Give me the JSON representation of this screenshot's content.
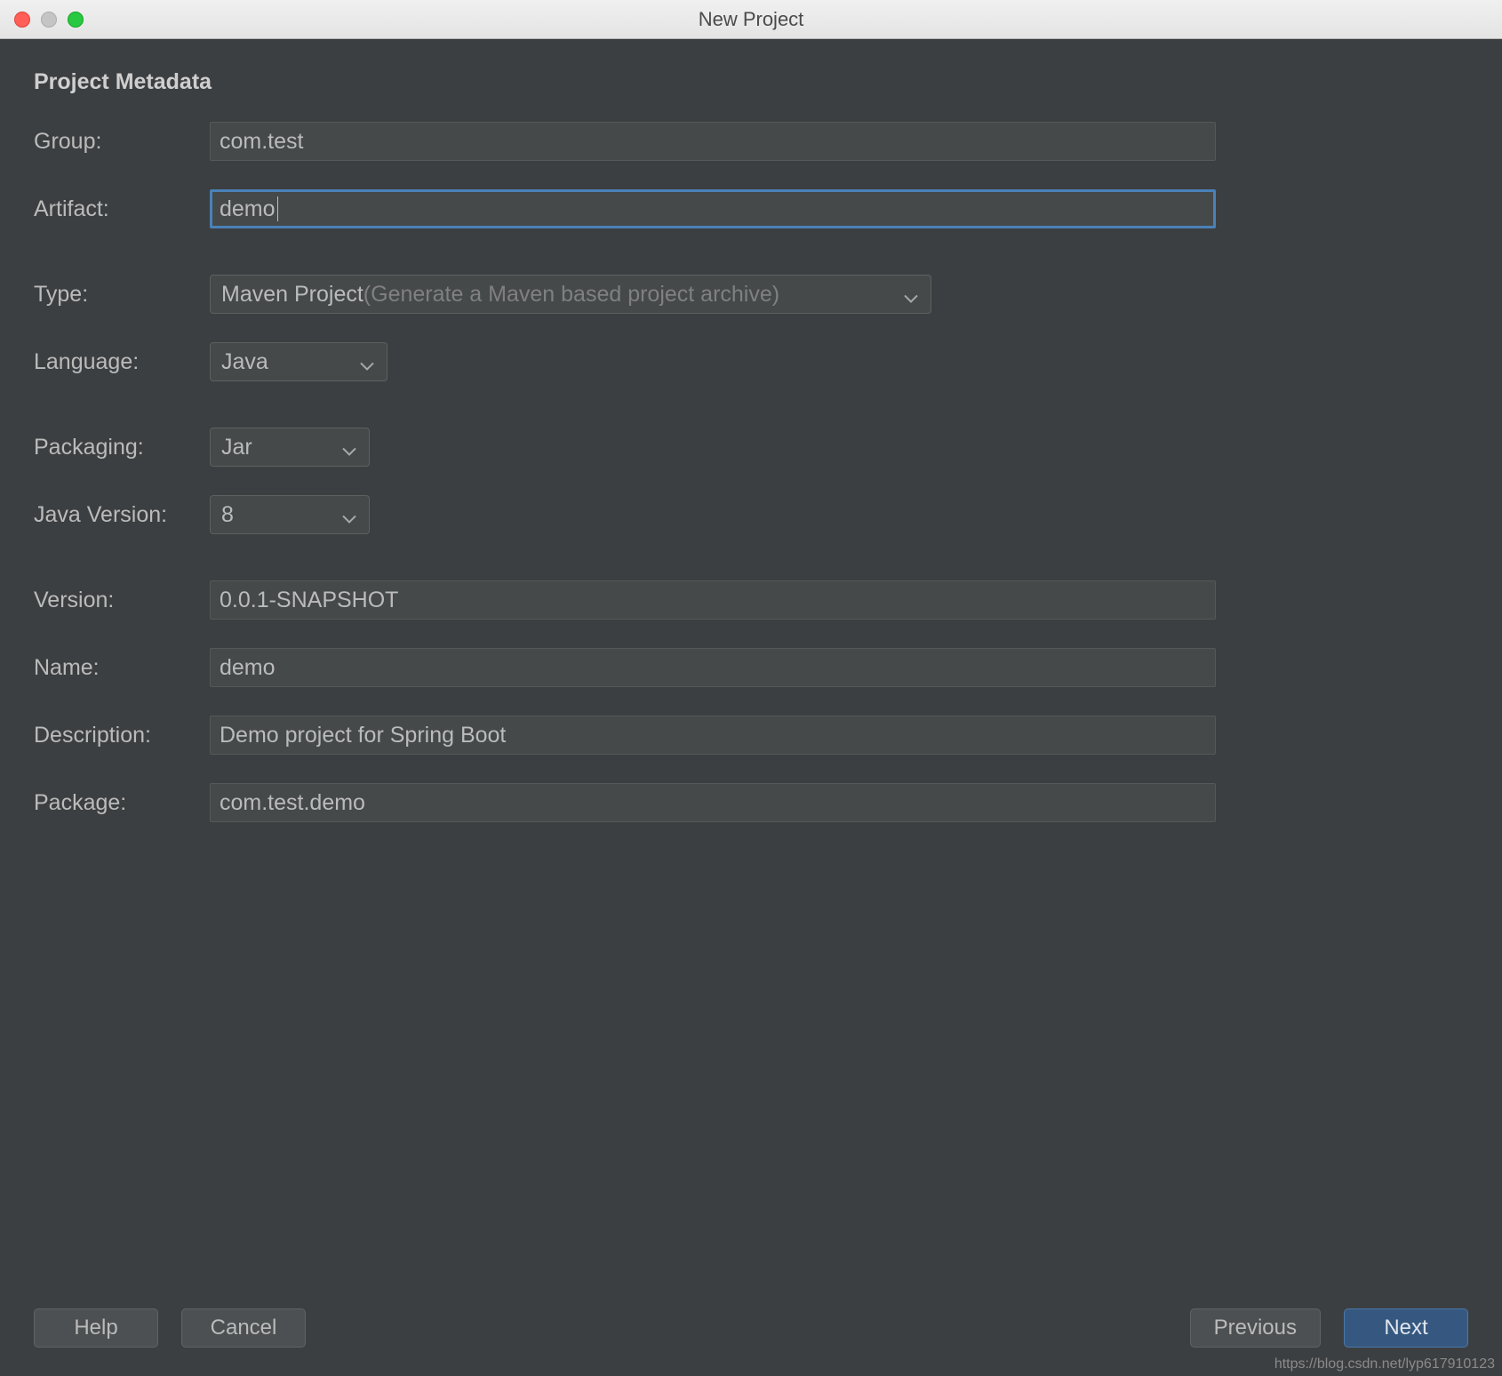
{
  "window_title": "New Project",
  "section_title": "Project Metadata",
  "labels": {
    "group": "Group:",
    "artifact": "Artifact:",
    "type": "Type:",
    "language": "Language:",
    "packaging": "Packaging:",
    "java_version": "Java Version:",
    "version": "Version:",
    "name": "Name:",
    "description": "Description:",
    "package": "Package:"
  },
  "values": {
    "group": "com.test",
    "artifact": "demo",
    "type_main": "Maven Project",
    "type_hint": " (Generate a Maven based project archive)",
    "language": "Java",
    "packaging": "Jar",
    "java_version": "8",
    "version": "0.0.1-SNAPSHOT",
    "name": "demo",
    "description": "Demo project for Spring Boot",
    "package": "com.test.demo"
  },
  "buttons": {
    "help": "Help",
    "cancel": "Cancel",
    "previous": "Previous",
    "next": "Next"
  },
  "watermark": "https://blog.csdn.net/lyp617910123"
}
